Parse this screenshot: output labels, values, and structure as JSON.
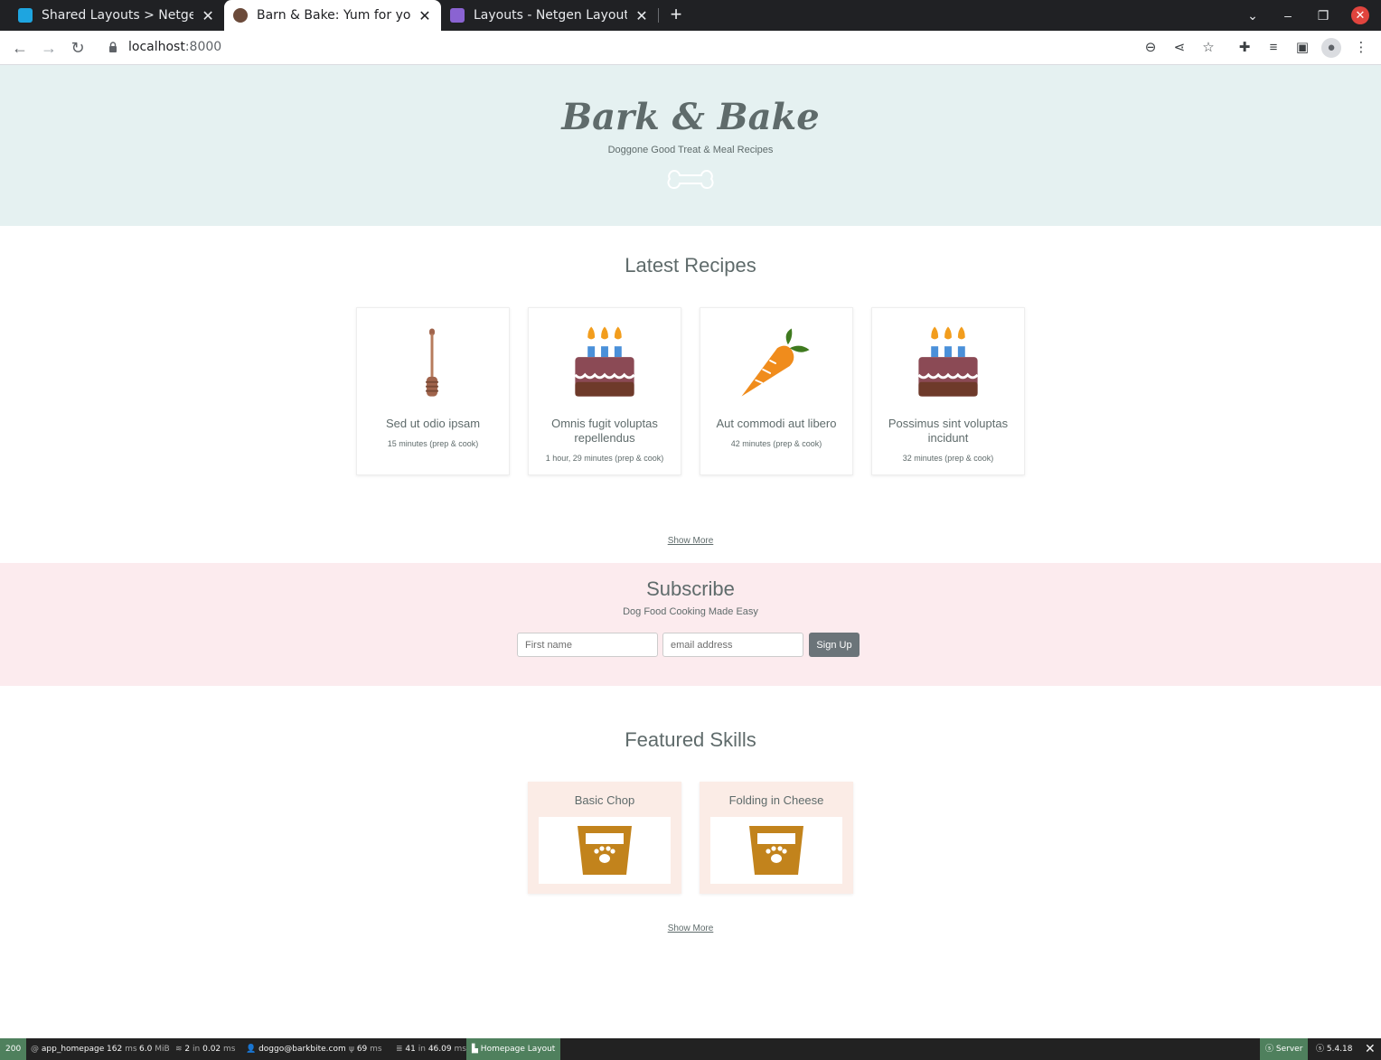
{
  "browser": {
    "tabs": [
      {
        "title": "Shared Layouts > Netgen Layouts",
        "active": false
      },
      {
        "title": "Barn & Bake: Yum for your dog",
        "active": true
      },
      {
        "title": "Layouts - Netgen Layouts",
        "active": false
      }
    ],
    "url_host": "localhost",
    "url_port": ":8000"
  },
  "hero": {
    "title": "Bark & Bake",
    "tagline": "Doggone Good Treat & Meal Recipes"
  },
  "latest": {
    "title": "Latest Recipes",
    "recipes": [
      {
        "name": "Sed ut odio ipsam",
        "time": "15 minutes (prep & cook)",
        "icon": "honey-dipper-icon"
      },
      {
        "name": "Omnis fugit voluptas repellendus",
        "time": "1 hour, 29 minutes (prep & cook)",
        "icon": "birthday-cake-icon"
      },
      {
        "name": "Aut commodi aut libero",
        "time": "42 minutes (prep & cook)",
        "icon": "carrot-icon"
      },
      {
        "name": "Possimus sint voluptas incidunt",
        "time": "32 minutes (prep & cook)",
        "icon": "birthday-cake-icon"
      }
    ],
    "show_more": "Show More"
  },
  "subscribe": {
    "title": "Subscribe",
    "subtitle": "Dog Food Cooking Made Easy",
    "first_name_placeholder": "First name",
    "email_placeholder": "email address",
    "button": "Sign Up"
  },
  "skills": {
    "title": "Featured Skills",
    "items": [
      {
        "name": "Basic Chop",
        "icon": "dog-bowl-icon"
      },
      {
        "name": "Folding in Cheese",
        "icon": "dog-bowl-icon"
      }
    ],
    "show_more": "Show More"
  },
  "debug_toolbar": {
    "status": "200",
    "route": "app_homepage",
    "time_value": "162",
    "time_unit": "ms",
    "memory_value": "6.0",
    "memory_unit": "MiB",
    "cache_value": "2",
    "cache_in": "in",
    "cache_time": "0.02",
    "cache_unit": "ms",
    "user": "doggo@barkbite.com",
    "twig_value": "69",
    "twig_unit": "ms",
    "db_value": "41",
    "db_in": "in",
    "db_time": "46.09",
    "db_unit": "ms",
    "layout": "Homepage Layout",
    "server": "Server",
    "version": "5.4.18"
  },
  "colors": {
    "hero_bg": "#e5f1f1",
    "subscribe_bg": "#fcebee",
    "skill_bg": "#fbece6",
    "text": "#5f6b6b",
    "signup_button": "#6b7479"
  }
}
